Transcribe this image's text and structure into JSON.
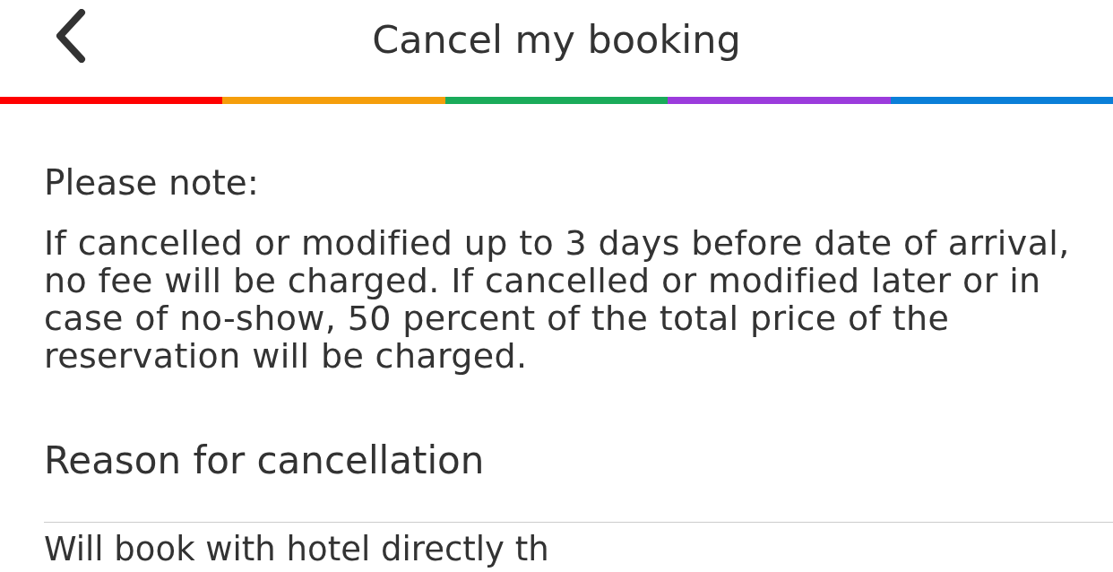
{
  "header": {
    "title": "Cancel my booking"
  },
  "rainbow_bar": {
    "segments": [
      {
        "color": "#ff0000"
      },
      {
        "color": "#f59e0b"
      },
      {
        "color": "#1aab5a"
      },
      {
        "color": "#9b3bdc"
      },
      {
        "color": "#0a7fd8"
      }
    ]
  },
  "notice": {
    "heading": "Please note:",
    "text": "If cancelled or modified up to 3 days before date of arrival, no fee will be charged. If cancelled or modified later or in case of no-show, 50 percent of the total price of the reservation will be charged."
  },
  "reason": {
    "heading": "Reason for cancellation",
    "options": [
      {
        "label": "Will book with hotel directly th"
      }
    ]
  }
}
